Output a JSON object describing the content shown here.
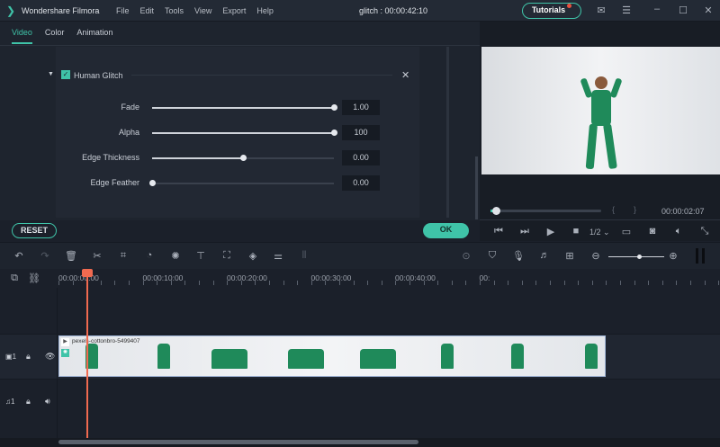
{
  "app": {
    "name": "Wondershare Filmora",
    "menu": [
      "File",
      "Edit",
      "Tools",
      "View",
      "Export",
      "Help"
    ],
    "project_title": "glitch : 00:00:42:10",
    "tutorials": "Tutorials"
  },
  "tabs": [
    "Video",
    "Color",
    "Animation"
  ],
  "effect": {
    "name": "Human Glitch",
    "params": [
      {
        "label": "Fade",
        "value": "1.00",
        "fraction": 1.0
      },
      {
        "label": "Alpha",
        "value": "100",
        "fraction": 1.0
      },
      {
        "label": "Edge Thickness",
        "value": "0.00",
        "fraction": 0.5
      },
      {
        "label": "Edge Feather",
        "value": "0.00",
        "fraction": 0.0
      }
    ]
  },
  "buttons": {
    "reset": "RESET",
    "ok": "OK"
  },
  "player": {
    "timecode": "00:00:02:07",
    "quality": "1/2",
    "progress": 0.05,
    "brackets": [
      "{",
      "}"
    ]
  },
  "ruler": [
    "00:00:00:00",
    "00:00:10:00",
    "00:00:20:00",
    "00:00:30:00",
    "00:00:40:00",
    "00:"
  ],
  "tracks": {
    "video_label": "1",
    "audio_label": "1",
    "clip_name": "pexels-cottonbro-5499407"
  }
}
